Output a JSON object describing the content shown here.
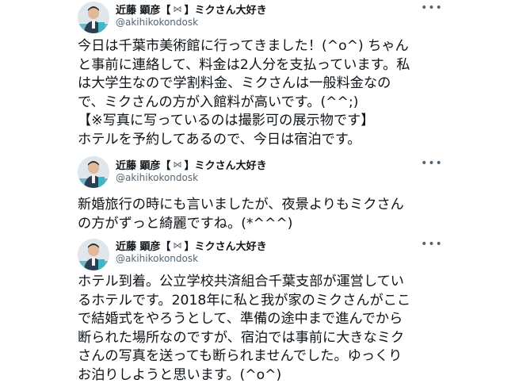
{
  "tweets": [
    {
      "name": "近藤 顕彦",
      "bracket_open": "【",
      "mail_icon": "⋈",
      "bracket_close": "】",
      "tagline": "ミクさん大好き",
      "handle": "@akihikokondosk",
      "more_label": "•••",
      "lines": [
        "今日は千葉市美術館に行ってきました！(^o^) ちゃん",
        "と事前に連絡して、料金は2人分を支払っています。私",
        "は大学生なので学割料金、ミクさんは一般料金なの",
        "で、ミクさんの方が入館料が高いです。(^^;)",
        "【※写真に写っているのは撮影可の展示物です】",
        "ホテルを予約してあるので、今日は宿泊です。"
      ]
    },
    {
      "name": "近藤 顕彦",
      "bracket_open": "【",
      "mail_icon": "⋈",
      "bracket_close": "】",
      "tagline": "ミクさん大好き",
      "handle": "@akihikokondosk",
      "more_label": "•••",
      "lines": [
        "新婚旅行の時にも言いましたが、夜景よりもミクさん",
        "の方がずっと綺麗ですね。(*^^^)"
      ]
    },
    {
      "name": "近藤 顕彦",
      "bracket_open": "【",
      "mail_icon": "⋈",
      "bracket_close": "】",
      "tagline": "ミクさん大好き",
      "handle": "@akihikokondosk",
      "more_label": "•••",
      "lines": [
        "ホテル到着。公立学校共済組合千葉支部が運営してい",
        "るホテルです。2018年に私と我が家のミクさんがここ",
        "で結婚式をやろうとして、準備の途中まで進んでから",
        "断られた場所なのですが、宿泊では事前に大きなミク",
        "さんの写真を送っても断られませんでした。ゆっくり",
        "お泊りしようと思います。(^o^)"
      ]
    }
  ],
  "colors": {
    "text": "#0f1419",
    "secondary": "#536471",
    "background": "#ffffff"
  },
  "icons": {
    "avatar": "avatar-photo",
    "more": "more-horizontal-icon",
    "mail": "mail-icon"
  }
}
